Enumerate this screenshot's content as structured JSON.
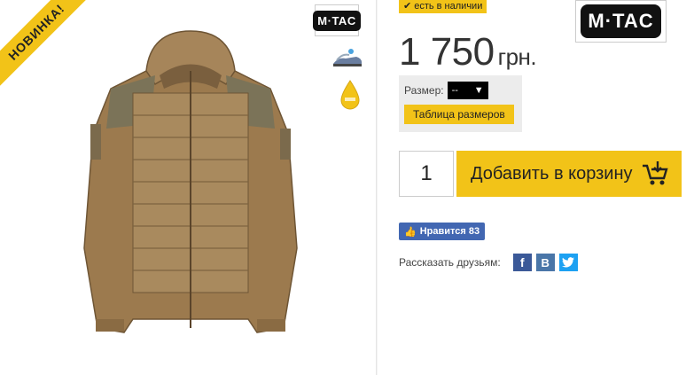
{
  "product": {
    "new_badge": "НОВИНКА!",
    "brand_logo_text": "M·TAC"
  },
  "stock": {
    "check_icon": "✔",
    "text": "есть в наличии"
  },
  "price": {
    "amount": "1 750",
    "currency": "грн."
  },
  "size": {
    "label": "Размер:",
    "selected": "--",
    "table_button": "Таблица размеров"
  },
  "cart": {
    "quantity": "1",
    "add_button": "Добавить в корзину"
  },
  "social": {
    "like_label": "Нравится 83",
    "share_label": "Рассказать друзьям:",
    "facebook": "f",
    "vk": "B"
  },
  "colors": {
    "accent": "#f2c318",
    "facebook": "#3b5998",
    "vk": "#4a76a8",
    "twitter": "#1da1f2"
  }
}
